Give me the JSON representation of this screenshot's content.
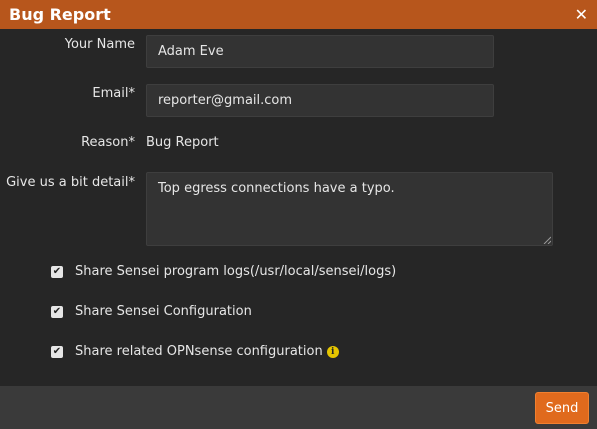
{
  "dialog": {
    "title": "Bug Report",
    "close_glyph": "✕",
    "close_icon": "close-icon"
  },
  "form": {
    "name_label": "Your Name",
    "name_value": "Adam Eve",
    "email_label": "Email*",
    "email_value": "reporter@gmail.com",
    "reason_label": "Reason*",
    "reason_value": "Bug Report",
    "detail_label": "Give us a bit detail*",
    "detail_value": "Top egress connections have a typo."
  },
  "options": [
    {
      "label": "Share Sensei program logs(/usr/local/sensei/logs)",
      "checked": true
    },
    {
      "label": "Share Sensei Configuration",
      "checked": true
    },
    {
      "label": "Share related OPNsense configuration",
      "checked": true,
      "info_icon": "info-icon"
    }
  ],
  "footer": {
    "send_label": "Send"
  },
  "colors": {
    "title_bar": "#b7561c",
    "accent": "#e06a1d",
    "background": "#262626",
    "info": "#e6c600"
  }
}
